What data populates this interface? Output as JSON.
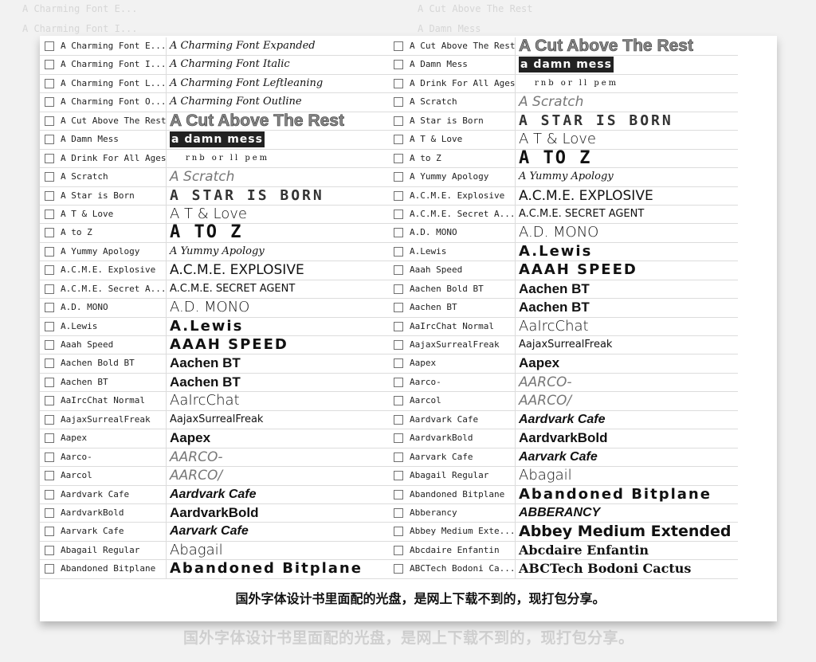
{
  "left_fonts": [
    {
      "name": "A Charming Font E...",
      "preview": "A Charming Font Expanded"
    },
    {
      "name": "A Charming Font I...",
      "preview": "A Charming Font Italic"
    },
    {
      "name": "A Charming Font L...",
      "preview": "A Charming Font Leftleaning"
    },
    {
      "name": "A Charming Font O...",
      "preview": "A Charming Font Outline"
    },
    {
      "name": "A Cut Above The Rest",
      "preview": "A Cut Above The Rest"
    },
    {
      "name": "A Damn Mess",
      "preview": "a damn mess"
    },
    {
      "name": "A Drink For All Ages",
      "preview": "rnb  or  ll  pem"
    },
    {
      "name": "A Scratch",
      "preview": "A Scratch"
    },
    {
      "name": "A Star is Born",
      "preview": "A STAR IS BORN"
    },
    {
      "name": "A T  & Love",
      "preview": "A T & Love"
    },
    {
      "name": "A to Z",
      "preview": "A TO Z"
    },
    {
      "name": "A Yummy Apology",
      "preview": "A Yummy Apology"
    },
    {
      "name": "A.C.M.E. Explosive",
      "preview": "A.C.M.E. EXPLOSIVE"
    },
    {
      "name": "A.C.M.E. Secret A...",
      "preview": "A.C.M.E. SECRET AGENT"
    },
    {
      "name": "A.D. MONO",
      "preview": "A.D. MONO"
    },
    {
      "name": "A.Lewis",
      "preview": "A.Lewis"
    },
    {
      "name": "Aaah Speed",
      "preview": "AAAH SPEED"
    },
    {
      "name": "Aachen Bold BT",
      "preview": "Aachen BT"
    },
    {
      "name": "Aachen BT",
      "preview": "Aachen BT"
    },
    {
      "name": "AaIrcChat Normal",
      "preview": "AaIrcChat"
    },
    {
      "name": "AajaxSurrealFreak",
      "preview": "AajaxSurrealFreak"
    },
    {
      "name": "Aapex",
      "preview": "Aapex"
    },
    {
      "name": "Aarco-",
      "preview": "AARCO-"
    },
    {
      "name": "Aarcol",
      "preview": "AARCO/"
    },
    {
      "name": "Aardvark Cafe",
      "preview": "Aardvark Cafe"
    },
    {
      "name": "AardvarkBold",
      "preview": "AardvarkBold"
    },
    {
      "name": "Aarvark Cafe",
      "preview": "Aarvark Cafe"
    },
    {
      "name": "Abagail Regular",
      "preview": "Abagail"
    },
    {
      "name": "Abandoned Bitplane",
      "preview": "Abandoned Bitplane"
    }
  ],
  "right_fonts": [
    {
      "name": "A Cut Above The Rest",
      "preview": "A Cut Above The Rest"
    },
    {
      "name": "A Damn Mess",
      "preview": "a damn mess"
    },
    {
      "name": "A Drink For All Ages",
      "preview": "rnb  or  ll  pem"
    },
    {
      "name": "A Scratch",
      "preview": "A Scratch"
    },
    {
      "name": "A Star is Born",
      "preview": "A STAR IS BORN"
    },
    {
      "name": "A T  & Love",
      "preview": "A T & Love"
    },
    {
      "name": "A to Z",
      "preview": "A TO Z"
    },
    {
      "name": "A Yummy Apology",
      "preview": "A Yummy Apology"
    },
    {
      "name": "A.C.M.E. Explosive",
      "preview": "A.C.M.E. EXPLOSIVE"
    },
    {
      "name": "A.C.M.E. Secret A...",
      "preview": "A.C.M.E. SECRET AGENT"
    },
    {
      "name": "A.D. MONO",
      "preview": "A.D. MONO"
    },
    {
      "name": "A.Lewis",
      "preview": "A.Lewis"
    },
    {
      "name": "Aaah Speed",
      "preview": "AAAH SPEED"
    },
    {
      "name": "Aachen Bold BT",
      "preview": "Aachen BT"
    },
    {
      "name": "Aachen BT",
      "preview": "Aachen BT"
    },
    {
      "name": "AaIrcChat Normal",
      "preview": "AaIrcChat"
    },
    {
      "name": "AajaxSurrealFreak",
      "preview": "AajaxSurrealFreak"
    },
    {
      "name": "Aapex",
      "preview": "Aapex"
    },
    {
      "name": "Aarco-",
      "preview": "AARCO-"
    },
    {
      "name": "Aarcol",
      "preview": "AARCO/"
    },
    {
      "name": "Aardvark Cafe",
      "preview": "Aardvark Cafe"
    },
    {
      "name": "AardvarkBold",
      "preview": "AardvarkBold"
    },
    {
      "name": "Aarvark Cafe",
      "preview": "Aarvark Cafe"
    },
    {
      "name": "Abagail Regular",
      "preview": "Abagail"
    },
    {
      "name": "Abandoned Bitplane",
      "preview": "Abandoned Bitplane"
    },
    {
      "name": "Abberancy",
      "preview": "ABBERANCY"
    },
    {
      "name": "Abbey Medium Exte...",
      "preview": "Abbey Medium Extended"
    },
    {
      "name": "Abcdaire Enfantin",
      "preview": "Abcdaire Enfantin"
    },
    {
      "name": "ABCTech Bodoni Ca...",
      "preview": "ABCTech Bodoni Cactus"
    }
  ],
  "caption": "国外字体设计书里面配的光盘，是网上下载不到的，现打包分享。"
}
